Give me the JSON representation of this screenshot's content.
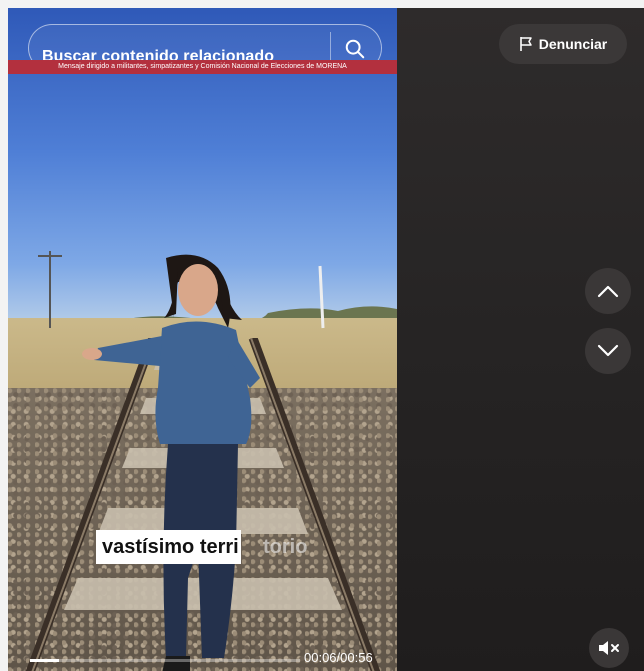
{
  "search": {
    "placeholder": "Buscar contenido relacionado"
  },
  "banner": {
    "text": "Mensaje dirigido a militantes, simpatizantes y Comisión Nacional de Elecciones de MORENA"
  },
  "caption": {
    "highlighted": "vastísimo terri",
    "faded": "torio"
  },
  "player": {
    "current_time": "00:06",
    "separator": "/",
    "duration": "00:56",
    "progress_fraction": 0.107
  },
  "actions": {
    "report_label": "Denunciar",
    "report_icon": "flag-icon",
    "prev_icon": "chevron-up-icon",
    "next_icon": "chevron-down-icon",
    "mute_icon": "volume-muted-icon"
  },
  "colors": {
    "banner": "#b3303e",
    "panel": "#2a2727",
    "button": "#3b3838"
  }
}
